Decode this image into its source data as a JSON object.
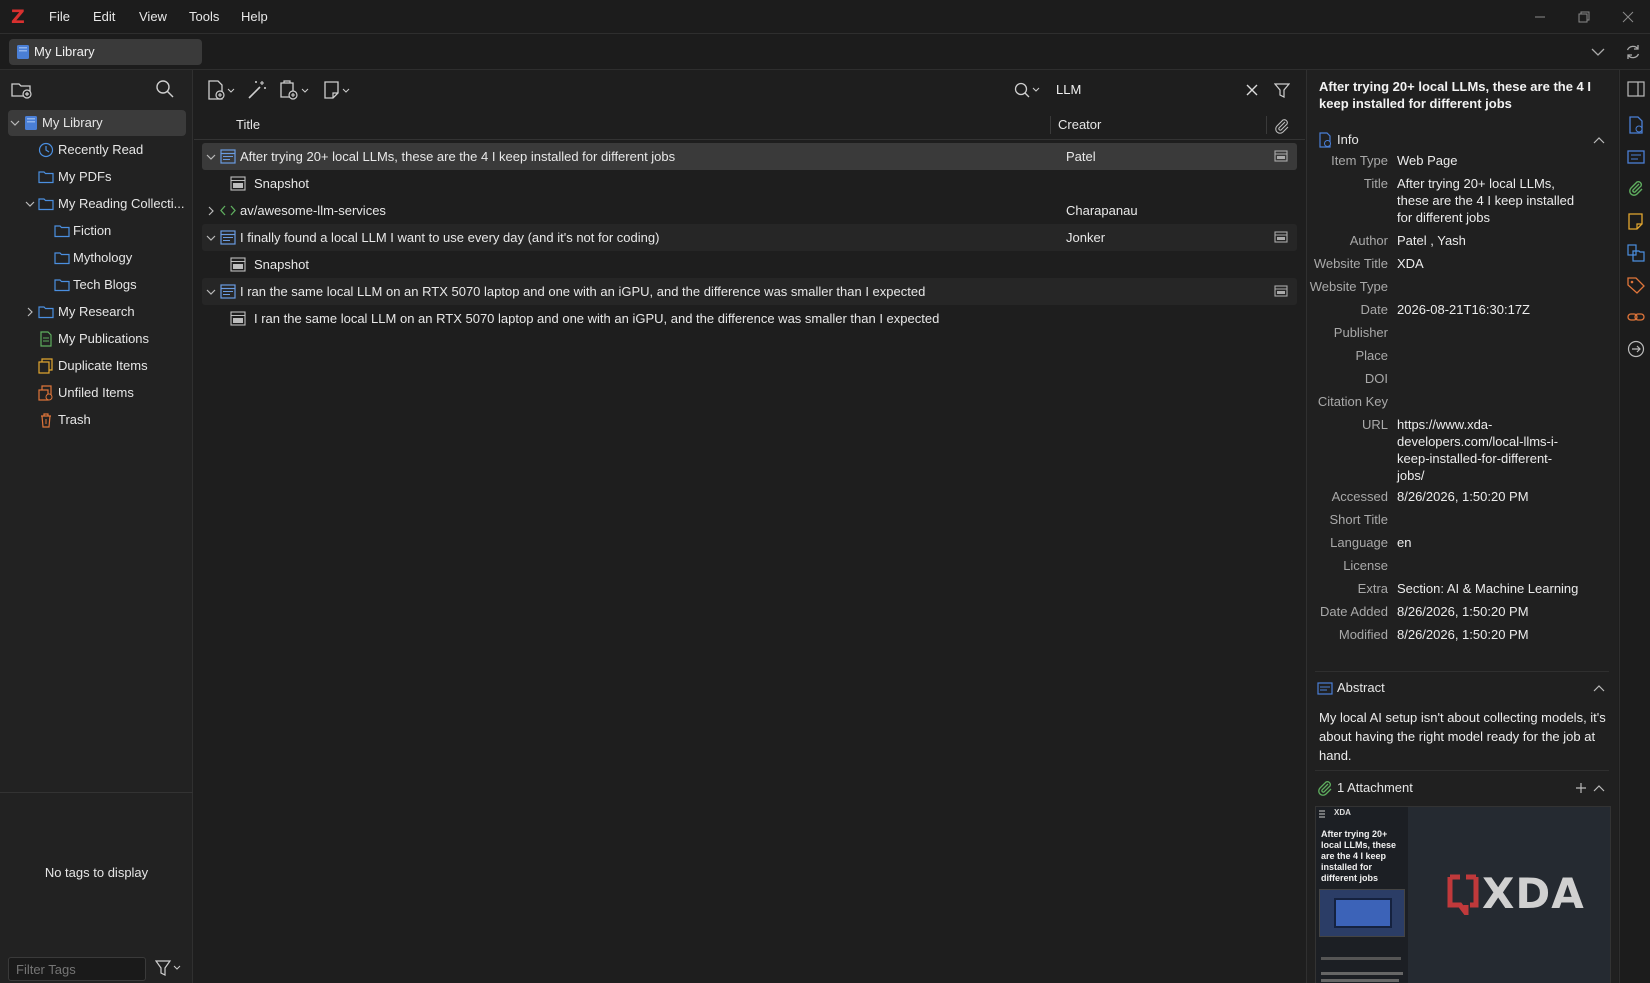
{
  "app": {
    "logo": "Z",
    "menu": [
      "File",
      "Edit",
      "View",
      "Tools",
      "Help"
    ]
  },
  "tabs": {
    "library_tab": "My Library"
  },
  "collections": {
    "items": [
      {
        "label": "My Library",
        "icon": "library-icon",
        "selected": true
      },
      {
        "label": "Recently Read",
        "icon": "clock-icon"
      },
      {
        "label": "My PDFs",
        "icon": "folder-icon"
      },
      {
        "label": "My Reading Collecti...",
        "icon": "folder-icon"
      },
      {
        "label": "Fiction",
        "icon": "folder-icon"
      },
      {
        "label": "Mythology",
        "icon": "folder-icon"
      },
      {
        "label": "Tech Blogs",
        "icon": "folder-icon"
      },
      {
        "label": "My Research",
        "icon": "folder-icon"
      },
      {
        "label": "My Publications",
        "icon": "publications-icon"
      },
      {
        "label": "Duplicate Items",
        "icon": "duplicate-icon"
      },
      {
        "label": "Unfiled Items",
        "icon": "unfiled-icon"
      },
      {
        "label": "Trash",
        "icon": "trash-icon"
      }
    ]
  },
  "tags": {
    "empty_message": "No tags to display",
    "filter_placeholder": "Filter Tags"
  },
  "search": {
    "value": "LLM"
  },
  "columns": {
    "title": "Title",
    "creator": "Creator"
  },
  "items": [
    {
      "title": "After trying 20+ local LLMs, these are the 4 I keep installed for different jobs",
      "creator": "Patel"
    },
    {
      "title": "Snapshot",
      "creator": ""
    },
    {
      "title": "av/awesome-llm-services",
      "creator": "Charapanau"
    },
    {
      "title": "I finally found a local LLM I want to use every day (and it's not for coding)",
      "creator": "Jonker"
    },
    {
      "title": "Snapshot",
      "creator": ""
    },
    {
      "title": "I ran the same local LLM on an RTX 5070 laptop and one with an iGPU, and the difference was smaller than I expected",
      "creator": ""
    },
    {
      "title": "I ran the same local LLM on an RTX 5070 laptop and one with an iGPU, and the difference was smaller than I expected",
      "creator": ""
    }
  ],
  "item_pane": {
    "header": "After trying 20+ local LLMs, these are the 4 I keep installed for different jobs",
    "info_label": "Info",
    "fields": {
      "item_type": {
        "label": "Item Type",
        "value": "Web Page"
      },
      "title": {
        "label": "Title",
        "value": "After trying 20+ local LLMs, these are the 4 I keep installed for different jobs"
      },
      "author": {
        "label": "Author",
        "value": "Patel , Yash"
      },
      "website_title": {
        "label": "Website Title",
        "value": "XDA"
      },
      "website_type": {
        "label": "Website Type",
        "value": ""
      },
      "date": {
        "label": "Date",
        "value": "2026-08-21T16:30:17Z"
      },
      "publisher": {
        "label": "Publisher",
        "value": ""
      },
      "place": {
        "label": "Place",
        "value": ""
      },
      "doi": {
        "label": "DOI",
        "value": ""
      },
      "citation_key": {
        "label": "Citation Key",
        "value": ""
      },
      "url": {
        "label": "URL",
        "value": "https://www.xda-developers.com/local-llms-i-keep-installed-for-different-jobs/"
      },
      "accessed": {
        "label": "Accessed",
        "value": "8/26/2026, 1:50:20 PM"
      },
      "short_title": {
        "label": "Short Title",
        "value": ""
      },
      "language": {
        "label": "Language",
        "value": "en"
      },
      "license": {
        "label": "License",
        "value": ""
      },
      "extra": {
        "label": "Extra",
        "value": "Section: AI & Machine Learning"
      },
      "date_added": {
        "label": "Date Added",
        "value": "8/26/2026, 1:50:20 PM"
      },
      "modified": {
        "label": "Modified",
        "value": "8/26/2026, 1:50:20 PM"
      }
    },
    "abstract_label": "Abstract",
    "abstract": "My local AI setup isn't about collecting models, it's about having the right model ready for the job at hand.",
    "attachments_label": "1 Attachment",
    "thumbnail": {
      "brand": "XDA",
      "headline": "After trying 20+ local LLMs, these are the 4 I keep installed for different jobs"
    }
  },
  "colors": {
    "accent": "#4a7fd6",
    "brand_red": "#d8302f",
    "folder_blue": "#4b8fe0",
    "attachment_green": "#5fae5f",
    "note_yellow": "#e3a72f",
    "tag_orange": "#e0753a"
  }
}
